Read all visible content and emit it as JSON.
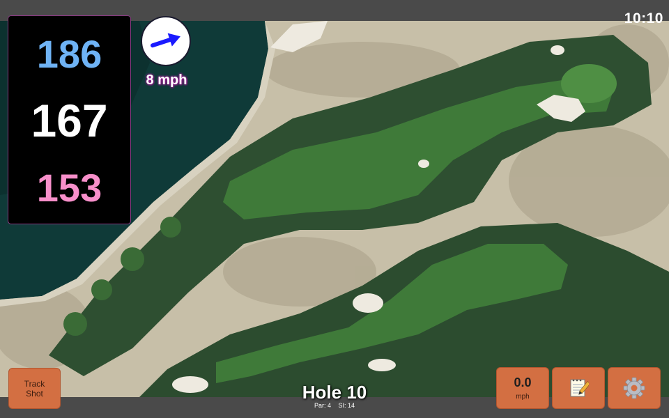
{
  "status": {
    "time": "10:10"
  },
  "distances": {
    "back": "186",
    "middle": "167",
    "front": "153"
  },
  "wind": {
    "speed": "8 mph",
    "direction_icon": "arrow-right-icon"
  },
  "hole": {
    "title": "Hole 10",
    "par": "Par: 4",
    "stroke_index": "SI: 14"
  },
  "buttons": {
    "track_shot_line1": "Track",
    "track_shot_line2": "Shot",
    "speed_value": "0.0",
    "speed_unit": "mph",
    "notes_icon": "notepad-icon",
    "settings_icon": "gear-icon"
  },
  "colors": {
    "back_distance": "#6fb3f5",
    "middle_distance": "#ffffff",
    "front_distance": "#f78fca",
    "button": "#d36f42",
    "wind_arrow": "#1a1aff"
  }
}
